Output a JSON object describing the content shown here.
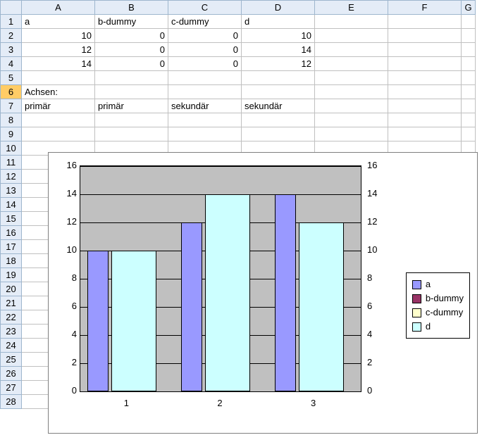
{
  "columns": [
    "A",
    "B",
    "C",
    "D",
    "E",
    "F",
    "G"
  ],
  "row_headers": [
    1,
    2,
    3,
    4,
    5,
    6,
    7,
    8,
    9,
    10,
    11,
    12,
    13,
    14,
    15,
    16,
    17,
    18,
    19,
    20,
    21,
    22,
    23,
    24,
    25,
    26,
    27,
    28
  ],
  "selected_row": 6,
  "cells": {
    "A1": "a",
    "B1": "b-dummy",
    "C1": "c-dummy",
    "D1": "d",
    "A2": "10",
    "B2": "0",
    "C2": "0",
    "D2": "10",
    "A3": "12",
    "B3": "0",
    "C3": "0",
    "D3": "14",
    "A4": "14",
    "B4": "0",
    "C4": "0",
    "D4": "12",
    "A6": "Achsen:",
    "A7": "primär",
    "B7": "primär",
    "C7": "sekundär",
    "D7": "sekundär"
  },
  "cell_align": {
    "A1": "l",
    "B1": "l",
    "C1": "l",
    "D1": "l",
    "A2": "r",
    "B2": "r",
    "C2": "r",
    "D2": "r",
    "A3": "r",
    "B3": "r",
    "C3": "r",
    "D3": "r",
    "A4": "r",
    "B4": "r",
    "C4": "r",
    "D4": "r",
    "A6": "l",
    "A7": "l",
    "B7": "l",
    "C7": "l",
    "D7": "l"
  },
  "chart_data": {
    "type": "bar",
    "categories": [
      "1",
      "2",
      "3"
    ],
    "series": [
      {
        "name": "a",
        "values": [
          10,
          12,
          14
        ],
        "axis": "primary",
        "color": "#9999ff"
      },
      {
        "name": "b-dummy",
        "values": [
          0,
          0,
          0
        ],
        "axis": "primary",
        "color": "#993366"
      },
      {
        "name": "c-dummy",
        "values": [
          0,
          0,
          0
        ],
        "axis": "secondary",
        "color": "#ffffcc"
      },
      {
        "name": "d",
        "values": [
          10,
          14,
          12
        ],
        "axis": "secondary",
        "color": "#ccffff"
      }
    ],
    "ylim": [
      0,
      16
    ],
    "y_ticks": [
      0,
      2,
      4,
      6,
      8,
      10,
      12,
      14,
      16
    ],
    "ylim_secondary": [
      0,
      16
    ],
    "y_ticks_secondary": [
      0,
      2,
      4,
      6,
      8,
      10,
      12,
      14,
      16
    ],
    "legend_position": "right",
    "grid": true
  },
  "legend": {
    "a": "a",
    "b": "b-dummy",
    "c": "c-dummy",
    "d": "d"
  }
}
